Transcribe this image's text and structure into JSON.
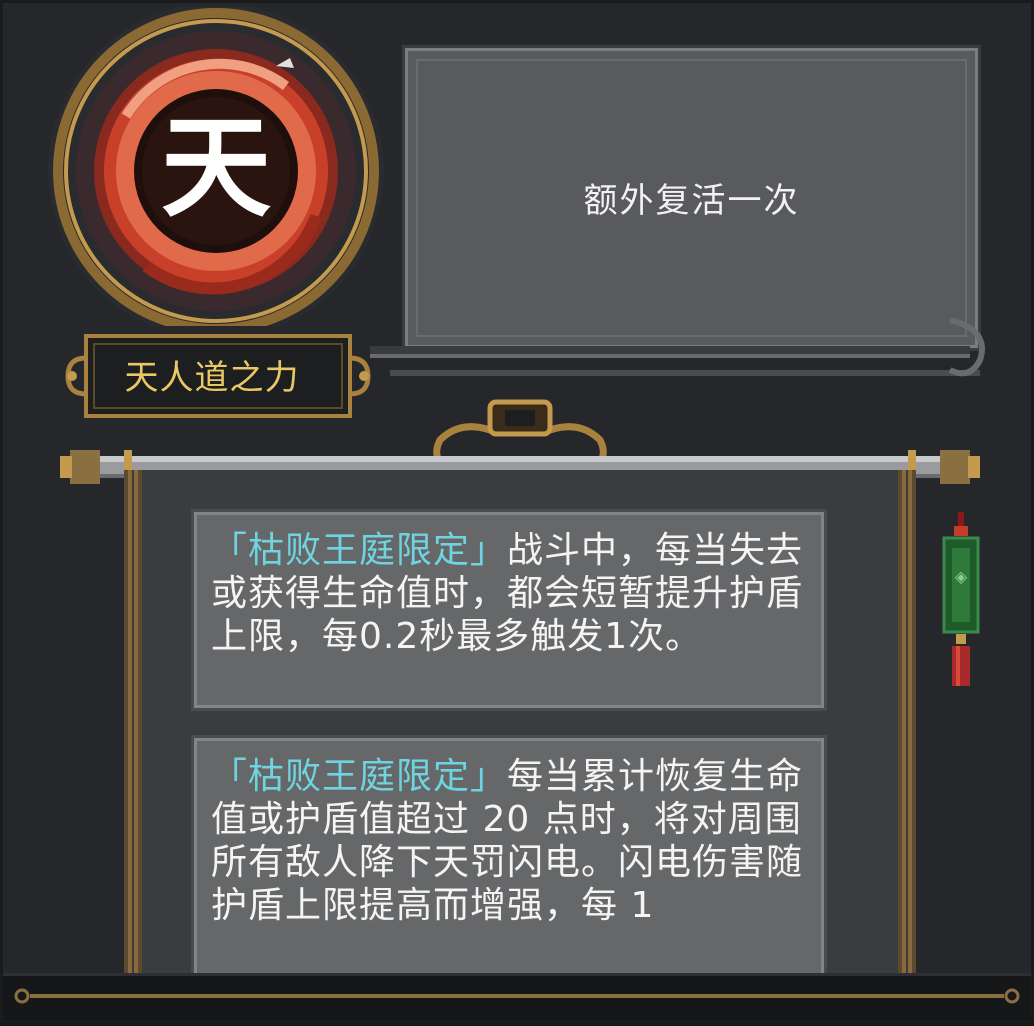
{
  "emblem": {
    "glyph": "天",
    "icon": "tianren-realm-emblem-icon"
  },
  "blessing": {
    "name": "天人道之力",
    "description": "额外复活一次"
  },
  "cards": [
    {
      "tag": "「枯败王庭限定」",
      "text": "战斗中，每当失去或获得生命值时，都会短暂提升护盾上限，每0.2秒最多触发1次。"
    },
    {
      "tag": "「枯败王庭限定」",
      "text": "每当累计恢复生命值或护盾值超过 20 点时，将对周围所有敌人降下天罚闪电。闪电伤害随护盾上限提高而增强，每 1"
    }
  ],
  "colors": {
    "background": "#26272a",
    "panel": "#595a5e",
    "card": "#666769",
    "title_gold": "#e8c866",
    "highlight_cyan": "#6fd4e0",
    "emblem_red": "#c8402a",
    "frame_gold": "#a8823e"
  }
}
